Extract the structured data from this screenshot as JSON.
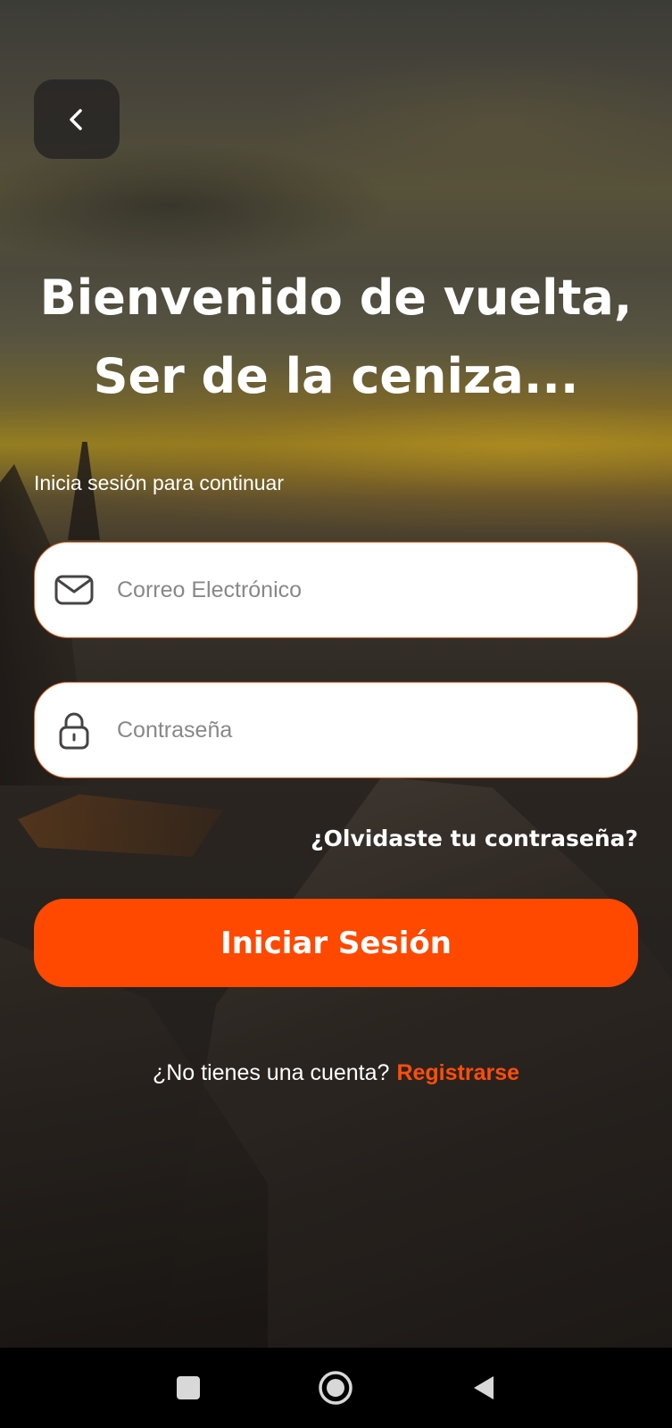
{
  "header": {
    "back_icon": "chevron-left-icon"
  },
  "welcome": {
    "title_line1": "Bienvenido de vuelta,",
    "title_line2": "Ser de la ceniza...",
    "subtitle": "Inicia sesión para continuar"
  },
  "form": {
    "email": {
      "placeholder": "Correo Electrónico",
      "value": "",
      "icon": "mail-icon"
    },
    "password": {
      "placeholder": "Contraseña",
      "value": "",
      "icon": "lock-icon"
    },
    "forgot_label": "¿Olvidaste tu contraseña?",
    "submit_label": "Iniciar Sesión"
  },
  "signup": {
    "prompt": "¿No tienes una cuenta?",
    "link_label": "Registrarse"
  },
  "colors": {
    "accent": "#ff4800",
    "link": "#ff4d0a",
    "field_border": "#e06a2a"
  },
  "system_nav": {
    "recent_icon": "square-icon",
    "home_icon": "circle-icon",
    "back_icon": "triangle-back-icon"
  }
}
